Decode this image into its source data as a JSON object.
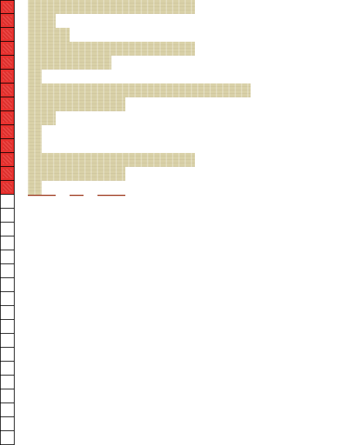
{
  "colors": {
    "gutter_mark": "#e8312e",
    "gutter_border": "#000000",
    "bar": "#d9d1a8",
    "tick": "#b0604a"
  },
  "gutter": {
    "cells": [
      {
        "marked": true
      },
      {
        "marked": true
      },
      {
        "marked": true
      },
      {
        "marked": true
      },
      {
        "marked": true
      },
      {
        "marked": true
      },
      {
        "marked": true
      },
      {
        "marked": true
      },
      {
        "marked": true
      },
      {
        "marked": true
      },
      {
        "marked": true
      },
      {
        "marked": true
      },
      {
        "marked": true
      },
      {
        "marked": true
      },
      {
        "marked": false
      },
      {
        "marked": false
      },
      {
        "marked": false
      },
      {
        "marked": false
      },
      {
        "marked": false
      },
      {
        "marked": false
      },
      {
        "marked": false
      },
      {
        "marked": false
      },
      {
        "marked": false
      },
      {
        "marked": false
      },
      {
        "marked": false
      },
      {
        "marked": false
      },
      {
        "marked": false
      },
      {
        "marked": false
      },
      {
        "marked": false
      },
      {
        "marked": false
      },
      {
        "marked": false
      },
      {
        "marked": false
      }
    ]
  },
  "content": {
    "lines": [
      {
        "blurred": true
      },
      {
        "blurred": true
      },
      {
        "blurred": true
      },
      {
        "blurred": true
      },
      {
        "blurred": true
      },
      {
        "blurred": true
      },
      {
        "blurred": true
      },
      {
        "blurred": true
      },
      {
        "blurred": true
      },
      {
        "blurred": true
      },
      {
        "blurred": true
      },
      {
        "blurred": true
      },
      {
        "blurred": true
      },
      {
        "blurred": true
      }
    ]
  }
}
